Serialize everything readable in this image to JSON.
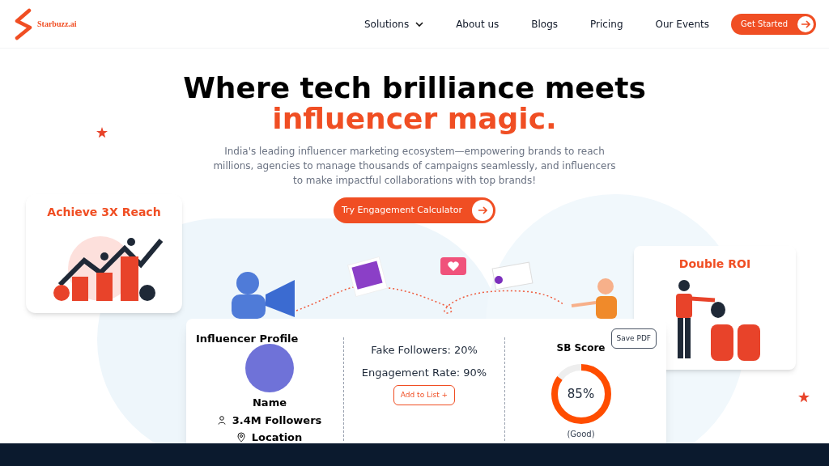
{
  "brand": {
    "name": "Starbuzz.ai"
  },
  "nav": [
    {
      "label": "Solutions",
      "dropdown": true
    },
    {
      "label": "About us",
      "dropdown": false
    },
    {
      "label": "Blogs",
      "dropdown": false
    },
    {
      "label": "Pricing",
      "dropdown": false
    },
    {
      "label": "Our Events",
      "dropdown": false
    }
  ],
  "cta": {
    "label": "Get Started"
  },
  "hero": {
    "title": "Where tech brilliance meets",
    "highlight": "influencer magic.",
    "subtitle": "India's leading influencer marketing ecosystem—empowering brands to reach millions, agencies to manage thousands of campaigns seamlessly, and influencers to make impactful collaborations with top brands!",
    "button": "Try Engagement Calculator"
  },
  "cards": [
    {
      "title": "Achieve 3X Reach"
    },
    {
      "title": "Double ROI"
    }
  ],
  "profile": {
    "title": "Influencer Profile",
    "save": "Save PDF",
    "name": "Name",
    "followers": "3.4M Followers",
    "location": "Location",
    "stats": [
      "Fake Followers: 20%",
      "Engagement Rate: 90%"
    ],
    "add": "Add to List +",
    "score_title": "SB Score",
    "score": {
      "level": 0.85,
      "reading": "85%"
    },
    "rating": "(Good)"
  }
}
